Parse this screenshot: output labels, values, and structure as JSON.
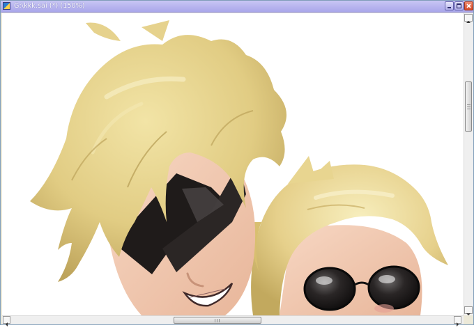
{
  "window": {
    "title": "G:\\kkk.sai (*) (150%)",
    "icon": "sai-app-icon",
    "controls": [
      "minimize-icon",
      "maximize-icon",
      "close-icon"
    ]
  },
  "canvas": {
    "content": "artwork",
    "subjects": [
      "blond-character-pointed-shades",
      "blond-character-round-shades"
    ]
  },
  "scrollbars": {
    "vertical": {
      "position_fraction": 0.3
    },
    "horizontal": {
      "position_fraction": 0.45
    }
  },
  "colors": {
    "titlebar": "#aba8ec",
    "hair": "#e4cf86",
    "skin": "#f3cdb5",
    "shades": "#24201f"
  }
}
